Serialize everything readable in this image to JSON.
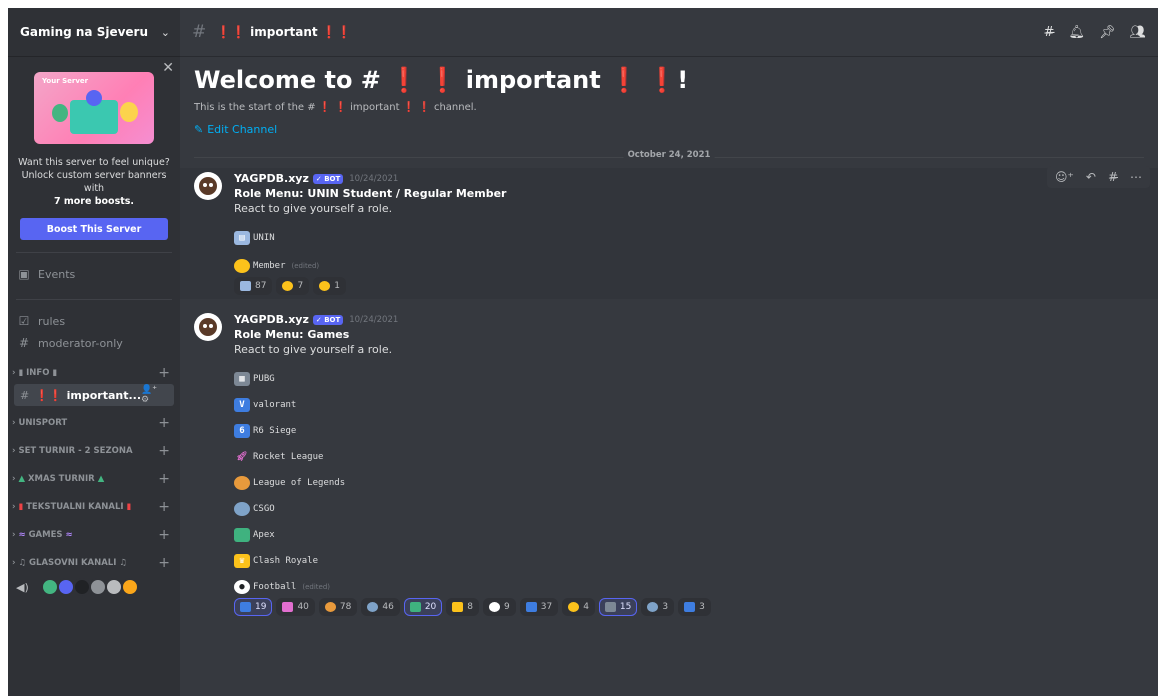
{
  "server": {
    "name": "Gaming na Sjeveru"
  },
  "boost": {
    "banner_title": "Your Server",
    "line1": "Want this server to feel unique?",
    "line2": "Unlock custom server banners with",
    "line3": "7 more boosts.",
    "button": "Boost This Server"
  },
  "sidebar": {
    "events": "Events",
    "rules": "rules",
    "moderator": "moderator-only",
    "info_category": "INFO",
    "active_channel": "important...",
    "categories": [
      "UNISPORT",
      "SET TURNIR - 2 SEZONA",
      "XMAS TURNIR",
      "TEKSTUALNI KANALI",
      "GAMES",
      "GLASOVNI KANALI"
    ]
  },
  "header": {
    "channel": "important"
  },
  "welcome": {
    "title_prefix": "Welcome to #",
    "title_name": "important",
    "title_suffix": "!",
    "sub_prefix": "This is the start of the #",
    "sub_name": "important",
    "sub_suffix": "channel.",
    "edit": "Edit Channel"
  },
  "date_divider": "October 24, 2021",
  "messages": [
    {
      "author": "YAGPDB.xyz",
      "badge": "✓ BOT",
      "timestamp": "10/24/2021",
      "title": "Role Menu: UNIN Student / Regular Member",
      "text": "React to give yourself a role.",
      "roles": [
        {
          "label": "UNIN",
          "edited": ""
        },
        {
          "label": "Member",
          "edited": "(edited)"
        }
      ],
      "reactions": [
        "87",
        "7",
        "1"
      ]
    },
    {
      "author": "YAGPDB.xyz",
      "badge": "✓ BOT",
      "timestamp": "10/24/2021",
      "title": "Role Menu: Games",
      "text": "React to give yourself a role.",
      "roles": [
        {
          "label": "PUBG",
          "edited": ""
        },
        {
          "label": "valorant",
          "edited": ""
        },
        {
          "label": "R6 Siege",
          "edited": ""
        },
        {
          "label": "Rocket League",
          "edited": ""
        },
        {
          "label": "League of Legends",
          "edited": ""
        },
        {
          "label": "CSGO",
          "edited": ""
        },
        {
          "label": "Apex",
          "edited": ""
        },
        {
          "label": "Clash Royale",
          "edited": ""
        },
        {
          "label": "Football",
          "edited": "(edited)"
        }
      ],
      "reactions": [
        "19",
        "40",
        "78",
        "46",
        "20",
        "8",
        "9",
        "37",
        "4",
        "15",
        "3",
        "3"
      ]
    }
  ],
  "colors": {
    "accent": "#5865f2",
    "link": "#00aff4",
    "red": "#ed4245"
  }
}
